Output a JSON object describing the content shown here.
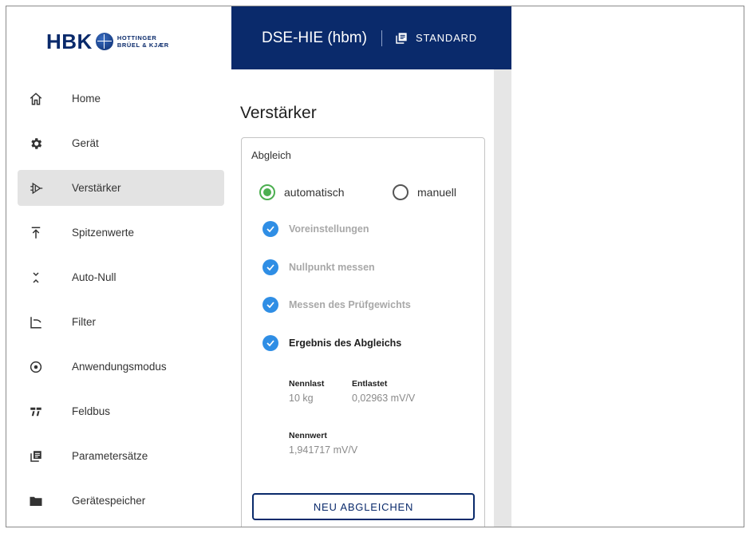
{
  "logo": {
    "brand": "HBK",
    "sub_line1": "HOTTINGER",
    "sub_line2": "BRÜEL & KJÆR"
  },
  "sidebar": {
    "items": [
      {
        "label": "Home",
        "icon": "home-icon"
      },
      {
        "label": "Gerät",
        "icon": "gear-icon"
      },
      {
        "label": "Verstärker",
        "icon": "amplifier-icon",
        "active": true
      },
      {
        "label": "Spitzenwerte",
        "icon": "peak-arrow-icon"
      },
      {
        "label": "Auto-Null",
        "icon": "auto-zero-icon"
      },
      {
        "label": "Filter",
        "icon": "filter-curve-icon"
      },
      {
        "label": "Anwendungsmodus",
        "icon": "target-icon"
      },
      {
        "label": "Feldbus",
        "icon": "fieldbus-icon"
      },
      {
        "label": "Parametersätze",
        "icon": "parameter-sets-icon"
      },
      {
        "label": "Gerätespeicher",
        "icon": "folder-icon"
      }
    ]
  },
  "header": {
    "device_name": "DSE-HIE (hbm)",
    "mode_label": "STANDARD",
    "bg_color": "#0a2a6b"
  },
  "main": {
    "title": "Verstärker",
    "card": {
      "title": "Abgleich",
      "radio_auto": "automatisch",
      "radio_manual": "manuell",
      "selected": "automatisch",
      "steps": [
        {
          "label": "Voreinstellungen",
          "state": "completed"
        },
        {
          "label": "Nullpunkt messen",
          "state": "completed"
        },
        {
          "label": "Messen des Prüfgewichts",
          "state": "completed"
        },
        {
          "label": "Ergebnis des Abgleichs",
          "state": "current"
        }
      ],
      "results": {
        "nennlast_label": "Nennlast",
        "nennlast_value": "10 kg",
        "entlastet_label": "Entlastet",
        "entlastet_value": "0,02963 mV/V",
        "nennwert_label": "Nennwert",
        "nennwert_value": "1,941717 mV/V"
      },
      "button_label": "NEU ABGLEICHEN"
    }
  },
  "colors": {
    "accent": "#0a2a6b",
    "check": "#2f8ee5",
    "radio_selected": "#4caf50"
  }
}
